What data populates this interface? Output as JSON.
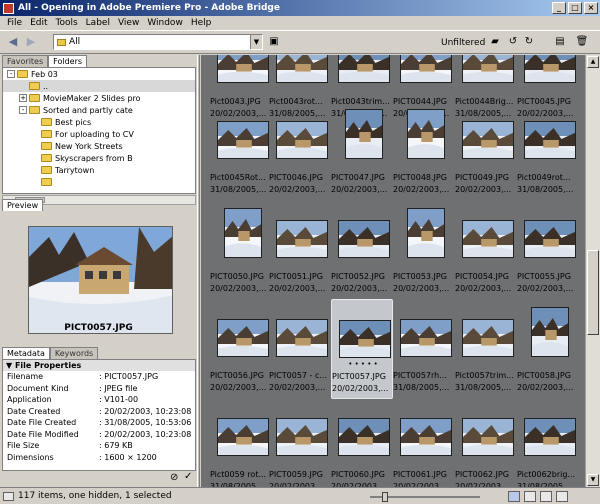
{
  "window": {
    "title": "All - Opening in Adobe Premiere Pro - Adobe Bridge"
  },
  "menu": [
    "File",
    "Edit",
    "Tools",
    "Label",
    "View",
    "Window",
    "Help"
  ],
  "toolbar": {
    "path": "All",
    "filter_label": "Unfiltered"
  },
  "left_tabs": {
    "favorites": "Favorites",
    "folders": "Folders"
  },
  "tree": [
    {
      "label": "Feb 03",
      "level": 0,
      "expander": "-",
      "selected": false
    },
    {
      "label": "..",
      "level": 1,
      "expander": "",
      "selected": true
    },
    {
      "label": "MovieMaker 2 Slides pro",
      "level": 1,
      "expander": "+",
      "selected": false
    },
    {
      "label": "Sorted and partly cate",
      "level": 1,
      "expander": "-",
      "selected": false
    },
    {
      "label": "Best pics",
      "level": 2,
      "expander": "",
      "selected": false
    },
    {
      "label": "For uploading to CV",
      "level": 2,
      "expander": "",
      "selected": false
    },
    {
      "label": "New York Streets",
      "level": 2,
      "expander": "",
      "selected": false
    },
    {
      "label": "Skyscrapers from B",
      "level": 2,
      "expander": "",
      "selected": false
    },
    {
      "label": "Tarrytown",
      "level": 2,
      "expander": "",
      "selected": false
    },
    {
      "label": "",
      "level": 2,
      "expander": "",
      "selected": false
    }
  ],
  "preview": {
    "tab": "Preview",
    "filename": "PICT0057.JPG"
  },
  "meta_tabs": {
    "metadata": "Metadata",
    "keywords": "Keywords"
  },
  "metadata": {
    "section": "File Properties",
    "rows": [
      {
        "k": "Filename",
        "v": ": PICT0057.JPG"
      },
      {
        "k": "Document Kind",
        "v": ": JPEG file"
      },
      {
        "k": "Application",
        "v": ": V101-00"
      },
      {
        "k": "Date Created",
        "v": ": 20/02/2003, 10:23:08"
      },
      {
        "k": "Date File Created",
        "v": ": 31/08/2005, 10:53:06"
      },
      {
        "k": "Date File Modified",
        "v": ": 20/02/2003, 10:23:08"
      },
      {
        "k": "File Size",
        "v": ": 679 KB"
      },
      {
        "k": "Dimensions",
        "v": ": 1600 × 1200"
      }
    ]
  },
  "thumbnails": [
    {
      "name": "Pict0043.JPG",
      "date": "20/02/2003,...",
      "kind": "landscape"
    },
    {
      "name": "Pict0043rot...",
      "date": "31/08/2005,...",
      "kind": "landscape"
    },
    {
      "name": "Pict0043trim...",
      "date": "31/08/2005,...",
      "kind": "landscape"
    },
    {
      "name": "PICT0044.JPG",
      "date": "20/02/2003,...",
      "kind": "landscape"
    },
    {
      "name": "Pict0044Brig...",
      "date": "31/08/2005,...",
      "kind": "landscape"
    },
    {
      "name": "PICT0045.JPG",
      "date": "20/02/2003,...",
      "kind": "landscape"
    },
    {
      "name": "Pict0045Rot...",
      "date": "31/08/2005,...",
      "kind": "landscape"
    },
    {
      "name": "PICT0046.JPG",
      "date": "20/02/2003,...",
      "kind": "landscape"
    },
    {
      "name": "PICT0047.JPG",
      "date": "20/02/2003,...",
      "kind": "portrait"
    },
    {
      "name": "PICT0048.JPG",
      "date": "20/02/2003,...",
      "kind": "portrait"
    },
    {
      "name": "PICT0049.JPG",
      "date": "20/02/2003,...",
      "kind": "landscape"
    },
    {
      "name": "Pict0049rot...",
      "date": "31/08/2005,...",
      "kind": "landscape"
    },
    {
      "name": "PICT0050.JPG",
      "date": "20/02/2003,...",
      "kind": "portrait"
    },
    {
      "name": "PICT0051.JPG",
      "date": "20/02/2003,...",
      "kind": "landscape"
    },
    {
      "name": "PICT0052.JPG",
      "date": "20/02/2003,...",
      "kind": "landscape"
    },
    {
      "name": "PICT0053.JPG",
      "date": "20/02/2003,...",
      "kind": "portrait"
    },
    {
      "name": "PICT0054.JPG",
      "date": "20/02/2003,...",
      "kind": "landscape"
    },
    {
      "name": "PICT0055.JPG",
      "date": "20/02/2003,...",
      "kind": "landscape"
    },
    {
      "name": "PICT0056.JPG",
      "date": "20/02/2003,...",
      "kind": "landscape"
    },
    {
      "name": "PICT0057 - c...",
      "date": "20/02/2003,...",
      "kind": "landscape"
    },
    {
      "name": "PICT0057.JPG",
      "date": "20/02/2003,...",
      "kind": "landscape",
      "selected": true,
      "dots": "• • • • •"
    },
    {
      "name": "PICT0057rh...",
      "date": "31/08/2005,...",
      "kind": "landscape"
    },
    {
      "name": "Pict0057trim...",
      "date": "31/08/2005,...",
      "kind": "landscape"
    },
    {
      "name": "PICT0058.JPG",
      "date": "20/02/2003,...",
      "kind": "portrait"
    },
    {
      "name": "Pict0059 rot...",
      "date": "31/08/2005,...",
      "kind": "landscape"
    },
    {
      "name": "PICT0059.JPG",
      "date": "20/02/2003,...",
      "kind": "landscape"
    },
    {
      "name": "PICT0060.JPG",
      "date": "20/02/2003,...",
      "kind": "landscape"
    },
    {
      "name": "PICT0061.JPG",
      "date": "20/02/2003,...",
      "kind": "landscape"
    },
    {
      "name": "PICT0062.JPG",
      "date": "20/02/2003,...",
      "kind": "landscape"
    },
    {
      "name": "Pict0062brig...",
      "date": "31/08/2005,...",
      "kind": "landscape"
    }
  ],
  "status": {
    "text": "117 items, one hidden, 1 selected"
  },
  "colors": {
    "content_bg": "#6e7072",
    "title_start": "#0a246a",
    "title_end": "#a6caf0"
  }
}
